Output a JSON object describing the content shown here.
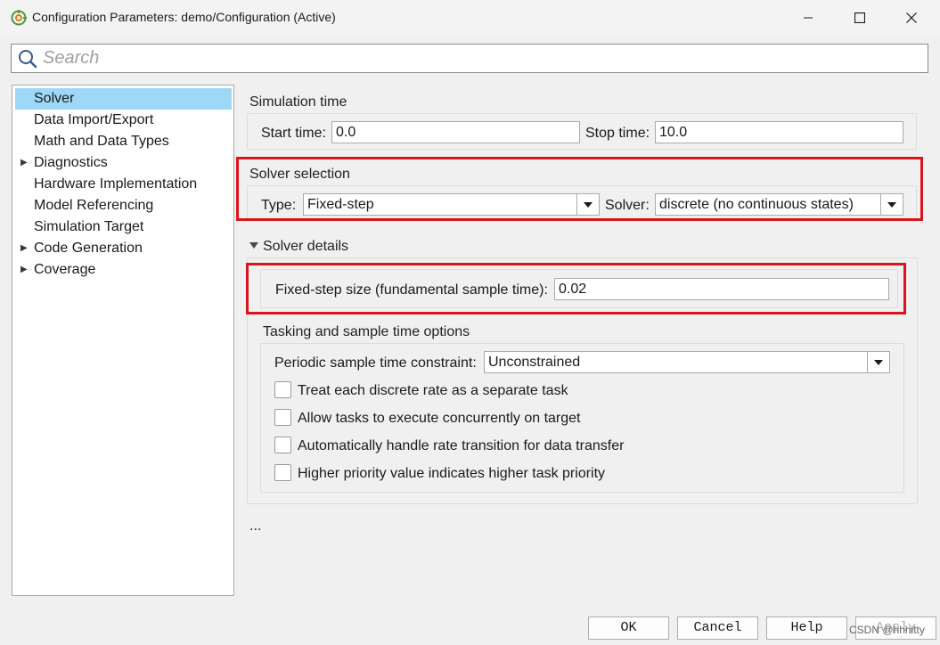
{
  "window": {
    "title": "Configuration Parameters: demo/Configuration (Active)"
  },
  "search": {
    "placeholder": "Search"
  },
  "tree": {
    "items": [
      {
        "label": "Solver",
        "expandable": false,
        "selected": true
      },
      {
        "label": "Data Import/Export",
        "expandable": false
      },
      {
        "label": "Math and Data Types",
        "expandable": false
      },
      {
        "label": "Diagnostics",
        "expandable": true
      },
      {
        "label": "Hardware Implementation",
        "expandable": false
      },
      {
        "label": "Model Referencing",
        "expandable": false
      },
      {
        "label": "Simulation Target",
        "expandable": false
      },
      {
        "label": "Code Generation",
        "expandable": true
      },
      {
        "label": "Coverage",
        "expandable": true
      }
    ]
  },
  "simulation_time": {
    "title": "Simulation time",
    "start_label": "Start time:",
    "start_value": "0.0",
    "stop_label": "Stop time:",
    "stop_value": "10.0"
  },
  "solver_selection": {
    "title": "Solver selection",
    "type_label": "Type:",
    "type_value": "Fixed-step",
    "solver_label": "Solver:",
    "solver_value": "discrete (no continuous states)"
  },
  "solver_details": {
    "title": "Solver details",
    "step_label": "Fixed-step size (fundamental sample time):",
    "step_value": "0.02"
  },
  "tasking": {
    "title": "Tasking and sample time options",
    "constraint_label": "Periodic sample time constraint:",
    "constraint_value": "Unconstrained",
    "checkboxes": [
      {
        "label": "Treat each discrete rate as a separate task",
        "checked": false
      },
      {
        "label": "Allow tasks to execute concurrently on target",
        "checked": false
      },
      {
        "label": "Automatically handle rate transition for data transfer",
        "checked": false
      },
      {
        "label": "Higher priority value indicates higher task priority",
        "checked": false
      }
    ]
  },
  "more": "...",
  "buttons": {
    "ok": "OK",
    "cancel": "Cancel",
    "help": "Help",
    "apply": "Apply"
  },
  "watermark": "CSDN @hhhitty",
  "colors": {
    "selection": "#9fd7f7",
    "highlight_box": "#d9141b"
  }
}
